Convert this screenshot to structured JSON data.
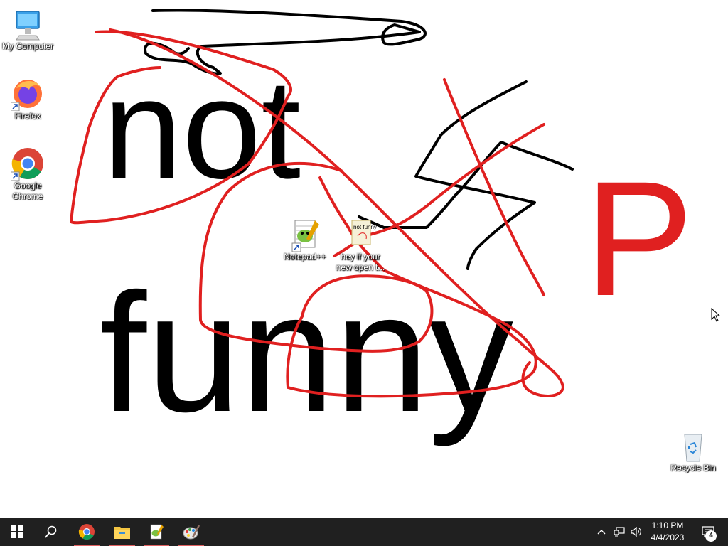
{
  "desktop": {
    "icons": [
      {
        "label": "My Computer",
        "icon": "computer-icon"
      },
      {
        "label": "Firefox",
        "icon": "firefox-icon"
      },
      {
        "label": "Google Chrome",
        "icon": "chrome-icon"
      },
      {
        "label": "Notepad++",
        "icon": "notepadpp-icon"
      },
      {
        "label": "hey if your new open t...",
        "icon": "image-file-icon"
      },
      {
        "label": "Recycle Bin",
        "icon": "recycle-bin-icon"
      }
    ],
    "file_thumb_text": "not funny"
  },
  "wallpaper": {
    "word1": "not",
    "word2": "funny",
    "letter": "P",
    "ink_black": "#000000",
    "ink_red": "#e02020"
  },
  "taskbar": {
    "pinned": [
      {
        "name": "start-icon"
      },
      {
        "name": "search-icon"
      },
      {
        "name": "chrome-icon",
        "running": true
      },
      {
        "name": "file-explorer-icon",
        "running": true
      },
      {
        "name": "notepadpp-icon",
        "running": true
      },
      {
        "name": "paint-icon",
        "running": true
      }
    ],
    "tray": {
      "time": "1:10 PM",
      "date": "4/4/2023",
      "notification_count": "4",
      "icons": [
        "chevron-up-icon",
        "network-icon",
        "volume-icon",
        "notification-icon"
      ]
    },
    "underline_color": "#e06060",
    "background": "#202020"
  }
}
